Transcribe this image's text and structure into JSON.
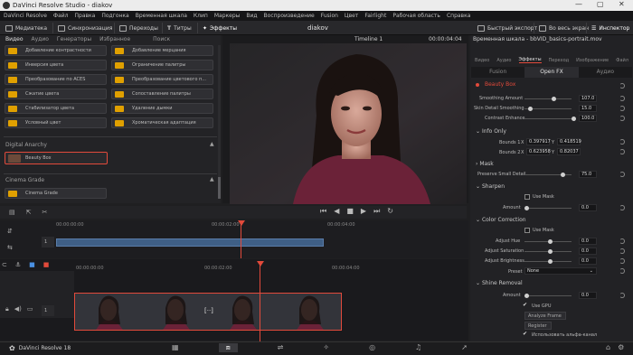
{
  "window": {
    "title": "DaVinci Resolve Studio - diakov",
    "minimize": "—",
    "maximize": "▢",
    "close": "✕"
  },
  "menu": [
    "DaVinci Resolve",
    "Файл",
    "Правка",
    "Подгонка",
    "Временная шкала",
    "Клип",
    "Маркеры",
    "Вид",
    "Воспроизведение",
    "Fusion",
    "Цвет",
    "Fairlight",
    "Рабочая область",
    "Справка"
  ],
  "toolbar": {
    "media": "Медиатека",
    "sync": "Синхронизация",
    "transitions": "Переходы",
    "titles": "Титры",
    "effects": "Эффекты",
    "project": "diakov",
    "quick_export": "Быстрый экспорт",
    "fullscreen": "Во весь экран",
    "inspector": "Инспектор"
  },
  "library": {
    "tabs": [
      "Видео",
      "Аудио",
      "Генераторы",
      "Избранное",
      "Поиск"
    ],
    "effects": [
      [
        "Добавление контрастности",
        "Добавление мерцания"
      ],
      [
        "Инверсия цвета",
        "Ограничение палитры"
      ],
      [
        "Преобразование по ACES",
        "Преобразование цветового п..."
      ],
      [
        "Сжатие цвета",
        "Сопоставление палитры"
      ],
      [
        "Стабилизатор цвета",
        "Удаление дымки"
      ],
      [
        "Условный цвет",
        "Хроматическая адаптация"
      ]
    ],
    "section_digital_anarchy": "Digital Anarchy",
    "beauty_box": "Beauty Box",
    "section_cinema": "Cinema Grade",
    "cinema_grade": "Cinema Grade"
  },
  "viewer": {
    "timeline_name": "Timeline 1",
    "timecode": "00:00:04:04"
  },
  "inspector": {
    "title": "Временная шкала - bbVID_basics-portrait.mov",
    "tabs": [
      "Видео",
      "Аудио",
      "Эффекты",
      "Переход",
      "Изображение",
      "Файл"
    ],
    "subtabs": [
      "Fusion",
      "Open FX",
      "Аудио"
    ],
    "plugin": "Beauty Box",
    "params": [
      {
        "label": "Smoothing Amount",
        "value": "107.0"
      },
      {
        "label": "Skin Detail Smoothing",
        "value": "15.0"
      },
      {
        "label": "Contrast Enhance",
        "value": "100.0"
      }
    ],
    "info_only": "Info Only",
    "bounds1": {
      "label": "Bounds 1",
      "x": "0.397917",
      "y": "0.418519"
    },
    "bounds2": {
      "label": "Bounds 2",
      "x": "0.623958",
      "y": "0.82037"
    },
    "mask": "Mask",
    "preserve": {
      "label": "Preserve Small Detail",
      "value": "75.0"
    },
    "sharpen": "Sharpen",
    "use_mask": "Use Mask",
    "sharpen_amount": {
      "label": "Amount",
      "value": "0.0"
    },
    "color_correction": "Color Correction",
    "use_mask2": "Use Mask",
    "adjust_hue": {
      "label": "Adjust Hue",
      "value": "0.0"
    },
    "adjust_sat": {
      "label": "Adjust Saturation",
      "value": "0.0"
    },
    "adjust_bri": {
      "label": "Adjust Brightness",
      "value": "0.0"
    },
    "preset": {
      "label": "Preset",
      "value": "None"
    },
    "shine": "Shine Removal",
    "shine_amount": {
      "label": "Amount",
      "value": "0.0"
    },
    "use_gpu": "Use GPU",
    "analyze": "Analyze Frame",
    "register": "Register",
    "alpha": "Использовать альфа-канал"
  },
  "timeline": {
    "ruler_top": [
      "00:00:00:00",
      "00:00:02:00",
      "00:00:04:00"
    ],
    "ruler_bottom": [
      "00:00:00:00",
      "00:00:02:00",
      "00:00:04:00"
    ]
  },
  "bottom": {
    "app": "DaVinci Resolve 18"
  }
}
